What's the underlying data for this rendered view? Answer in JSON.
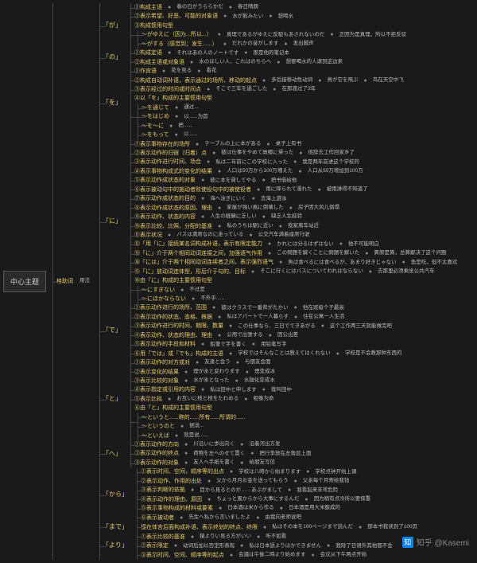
{
  "root": "中心主题",
  "main": "格助词",
  "usage": "用法",
  "watermark": {
    "logo": "知",
    "user": "知乎 @Kasemi"
  },
  "particles": [
    {
      "name": "「が」",
      "items": [
        {
          "t": "①构成主语",
          "ex": [
            "春の日がうららかだ",
            "春日晴朗"
          ]
        },
        {
          "t": "②表示希望、好恶、可能的对象语",
          "ex": [
            "水が飲みたい",
            "想喝水"
          ]
        },
        {
          "t": "③构成惯用句型",
          "sub": [
            {
              "t": "〜がゆえに（因为...所以...）",
              "ex": [
                "真理であるがゆえに反駁もあされないのだ",
                "正因为是真理，所以不拒反驳"
              ]
            },
            {
              "t": "〜がする（感觉到；发生......）",
              "ex": [
                "だれかの音がします",
                "发出脚声"
              ]
            }
          ]
        }
      ]
    },
    {
      "name": "「の」",
      "items": [
        {
          "t": "①构成定语",
          "ex": [
            "それはあの人のノートです",
            "那是他的笔记本"
          ]
        },
        {
          "t": "②构成主语或对象语",
          "ex": [
            "水のほしい人、これはのちらへ",
            "想要喝水的人请到这边来"
          ]
        }
      ]
    },
    {
      "name": "「を」",
      "items": [
        {
          "t": "①作宾语",
          "ex": [
            "花を見る",
            "看花"
          ]
        },
        {
          "t": "②构成自动词补语，表示通过的场所、移动的起点",
          "ex": [
            "多后接移动性动词",
            "鳥が空を飛ぶ",
            "鸟在天空中飞"
          ]
        },
        {
          "t": "③表示经过的时间或时间点",
          "ex": [
            "そこで三年を過ごした",
            "在那渡过了3年"
          ]
        },
        {
          "t": "④以「を」构成的主要惯用句型",
          "sub": [
            {
              "t": "〜を通じて",
              "ex": [
                "通过..."
              ]
            },
            {
              "t": "〜をはじめ",
              "ex": [
                "以......为首"
              ]
            },
            {
              "t": "〜を〜に",
              "ex": [
                "把......"
              ]
            },
            {
              "t": "〜をもって",
              "ex": [
                "以......"
              ]
            }
          ]
        }
      ]
    },
    {
      "name": "「に」",
      "items": [
        {
          "t": "①表示事物存在的场所",
          "ex": [
            "テーブルの上に本がある",
            "桌子上有书"
          ]
        },
        {
          "t": "②表示动作的归宿（归着）点",
          "ex": [
            "彼は仕事をやめて故郷に帰った",
            "他辞去工作回家乡了"
          ]
        },
        {
          "t": "③表示动作进行时间、场合",
          "ex": [
            "私は二年前にこの学校に入った",
            "我是两年前进这个学校的"
          ]
        },
        {
          "t": "④表示事物构成式的变化的结果",
          "ex": [
            "人口は50万から100万増えた",
            "人口从50万增加到100万"
          ]
        },
        {
          "t": "⑤表示动作成状态的对象",
          "ex": [
            "彼に本を貸してやる",
            "把书借给他"
          ]
        },
        {
          "t": "⑥表示被动句中的施动者败使役句中的被使役者",
          "ex": [
            "雨に降られて濡れた",
            "被雨淋得不知道了"
          ]
        },
        {
          "t": "⑦表示动作成状态的目的",
          "ex": [
            "海へ泳ぎにいく",
            "去海上游泳"
          ]
        },
        {
          "t": "⑧表示动作成状态的原因、理由",
          "ex": [
            "家屋が強い風に倒壊した",
            "房子因大风儿倒塌"
          ]
        },
        {
          "t": "⑨表示动作、状态的内容",
          "ex": [
            "人生の経験に乏しい",
            "缺乏人生经验"
          ]
        },
        {
          "t": "⑩表示比较、比照、分配的基准",
          "ex": [
            "私のうちは駅に近い",
            "我家离车站近"
          ]
        },
        {
          "t": "⑪表示状况",
          "ex": [
            "バスは満席なのに走っている",
            "公交汽车满着座席行驶"
          ]
        },
        {
          "t": "⑫「用「に」接続某名词构成补语，表示有限定能力",
          "ex": [
            "かれには分るはずはない",
            "他不可能明白"
          ]
        },
        {
          "t": "⑬「に」介于两个相同动词连接之间，加强语气作用",
          "ex": [
            "この問題を解くことに問題を解いた",
            "算原是算，总算解决了这个问题"
          ]
        },
        {
          "t": "⑭「には」介于两个相同动词连续者之间、表示强烈语气",
          "ex": [
            "魚は食べるには食べるが、あまり好きじゃない",
            "鱼是吃，但不太喜欢"
          ]
        },
        {
          "t": "⑮「に」放动词连体型，形后介于句的、目标",
          "ex": [
            "そこに行くにはバスについてわれはならない",
            "去那里必须乘坐公共汽车"
          ]
        },
        {
          "t": "⑯由「に」构成的主要惯用句型",
          "sub": [
            {
              "t": "〜にすぎない",
              "ex": [
                "不过是"
              ]
            },
            {
              "t": "〜にほかならない",
              "ex": [
                "不外乎......"
              ]
            }
          ]
        }
      ]
    },
    {
      "name": "「で」",
      "items": [
        {
          "t": "①表示动作进行的场所、范围",
          "ex": [
            "彼はクラスで一番背がたかい",
            "他在班级个子最高"
          ]
        },
        {
          "t": "②表示动作的状态、态格、根据",
          "ex": [
            "私はアパートで一人暮らす",
            "住在公寓一人生活"
          ]
        },
        {
          "t": "③表示动作进行的时间、期限、数量",
          "ex": [
            "この仕事なら、三日でできあがる",
            "这个工作两三天就能做完吧"
          ]
        },
        {
          "t": "④表示动作、状态的理由、理由",
          "ex": [
            "公用で出張する",
            "因公出差"
          ]
        },
        {
          "t": "⑤表示动作的手段和材料",
          "ex": [
            "鉛筆で字を書く",
            "用铅笔写字"
          ]
        },
        {
          "t": "⑥用「では」或「でも」构成的主语",
          "ex": [
            "学校ではそんなことは教えてはくれない",
            "学校是不会教那种东西的"
          ]
        }
      ]
    },
    {
      "name": "「と」",
      "items": [
        {
          "t": "①表示动作的对方或对",
          "ex": [
            "友達と会う",
            "与朋友会面"
          ]
        },
        {
          "t": "②表示变化的结果",
          "ex": [
            "煙が氷と変わります",
            "煙变成冰"
          ]
        },
        {
          "t": "③表示比较的对象",
          "ex": [
            "水が氷となった",
            "水融化变成水"
          ]
        },
        {
          "t": "④表示指定或引用的内容",
          "ex": [
            "私は田中と申します",
            "我叫田中"
          ]
        },
        {
          "t": "⑤表示比拟",
          "ex": [
            "お互いに枝と枝をたわめる",
            "相像为命"
          ]
        },
        {
          "t": "⑥由「と」构成的主要惯用句型",
          "sub": [
            {
              "t": "〜というと......称的......所有......所谓的......"
            },
            {
              "t": "〜というのと",
              "ex": [
                "据说..."
              ]
            },
            {
              "t": "〜といえば",
              "ex": [
                "就是说......"
              ]
            }
          ]
        }
      ]
    },
    {
      "name": "「へ」",
      "items": [
        {
          "t": "①表示动作的方向",
          "ex": [
            "川沿いに歩出向く",
            "沿着河出方发"
          ]
        },
        {
          "t": "②表示动作的终点",
          "ex": [
            "荷物を左へのせて置く",
            "把行李放在左角层上面"
          ]
        },
        {
          "t": "③表示动作的对象",
          "ex": [
            "友人へ手紙を書く",
            "给朋友写信"
          ]
        }
      ]
    },
    {
      "name": "「から」",
      "items": [
        {
          "t": "①表示时间、空间，顺序等的出点",
          "ex": [
            "学校は八時から始まります",
            "学校点钟开始上课"
          ]
        },
        {
          "t": "②表示动作、作用的出处",
          "ex": [
            "父から月月お金を送ってもらう",
            "父亲每个月寄给我钱"
          ]
        },
        {
          "t": "③表示判断的依拠",
          "ex": [
            "目から見るとのが……あぶがまして",
            "我看起来非常危险"
          ]
        },
        {
          "t": "④表示动作的理由、原因",
          "ex": [
            "ちょっと風からから大事にするんだ",
            "因为稍有点冷所以要保重"
          ]
        },
        {
          "t": "⑤表示事物构成的材料或要素",
          "ex": [
            "日本酒は米から作る",
            "日本酒是用大米酿成的"
          ]
        },
        {
          "t": "⑥表示被动者",
          "ex": [
            "先生へ私から言いましたよ",
            "由我向老师说吧"
          ]
        }
      ]
    },
    {
      "name": "「まで」",
      "items": [
        {
          "t": "接在体言后面构成补语、表示终划的终点、终限",
          "ex": [
            "私はその本を100ページまで読んだ",
            "那本书我读到了100页"
          ]
        }
      ]
    },
    {
      "name": "「より」",
      "items": [
        {
          "t": "①表示比较的基准",
          "ex": [
            "猿よりい見る方がいい",
            "听不如看"
          ]
        },
        {
          "t": "②表示限定",
          "ex": [
            "动词后加以否定形表现",
            "私は日本語よりほかできません",
            "我除了日语外其他都不会"
          ]
        },
        {
          "t": "③表示时间、空间、顺序等的起点",
          "ex": [
            "会議は午後二時より始めます",
            "会议从下午两点开始"
          ]
        }
      ]
    }
  ]
}
